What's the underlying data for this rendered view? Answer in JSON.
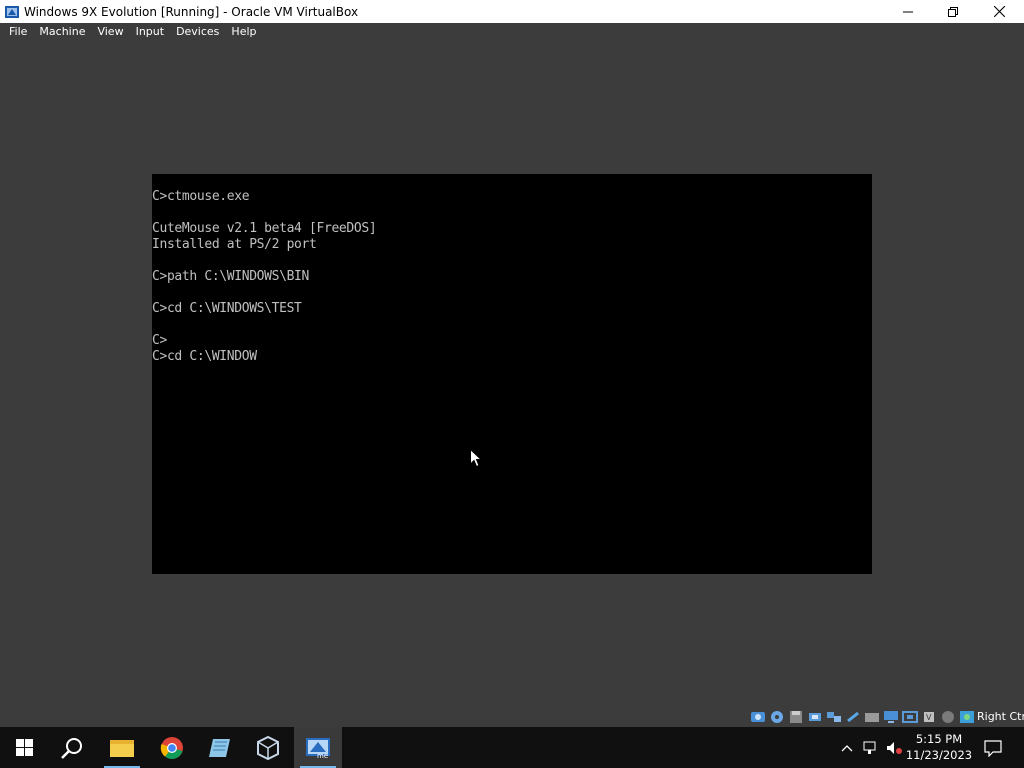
{
  "window": {
    "title": "Windows 9X Evolution [Running] - Oracle VM VirtualBox"
  },
  "menubar": {
    "items": [
      {
        "label": "File"
      },
      {
        "label": "Machine"
      },
      {
        "label": "View"
      },
      {
        "label": "Input"
      },
      {
        "label": "Devices"
      },
      {
        "label": "Help"
      }
    ]
  },
  "console": {
    "lines": [
      "C>ctmouse.exe",
      "",
      "CuteMouse v2.1 beta4 [FreeDOS]",
      "Installed at PS/2 port",
      "",
      "C>path C:\\WINDOWS\\BIN",
      "",
      "C>cd C:\\WINDOWS\\TEST",
      "",
      "C>",
      "C>cd C:\\WINDOW"
    ]
  },
  "statusbar": {
    "icons": [
      "hard-disk-icon",
      "optical-drive-icon",
      "floppy-icon",
      "audio-icon",
      "network-icon",
      "usb-icon",
      "shared-folders-icon",
      "display-icon",
      "video-capture-icon",
      "cpu-icon",
      "mouse-integration-icon",
      "keyboard-capture-icon"
    ],
    "host_key": "Right Ctrl"
  },
  "taskbar": {
    "apps": [
      "start-icon",
      "search-icon",
      "file-explorer-icon",
      "chrome-icon",
      "notepad-icon",
      "virtualbox-icon",
      "virtualbox-vm-icon"
    ],
    "clock_time": "5:15 PM",
    "clock_date": "11/23/2023"
  },
  "colors": {
    "vm_background": "#3c3c3c",
    "console_text": "#c0c0c0",
    "taskbar": "#101010",
    "accent": "#76b9ed"
  }
}
